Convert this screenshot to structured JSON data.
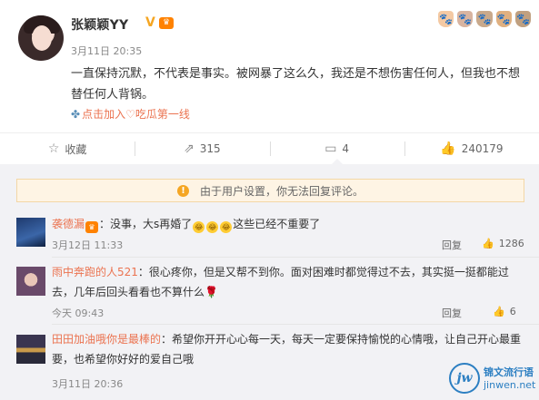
{
  "post": {
    "username": "张颖颖YY",
    "verified_mark": "V",
    "level_badge": "♛",
    "time": "3月11日 20:35",
    "content": "一直保持沉默，不代表是事实。被网暴了这么久，我还是不想伤害任何人，但我也不想替任何人背锅。",
    "topic_icon": "✤",
    "topic": "点击加入♡吃瓜第一线",
    "deco_cats": [
      "🐾",
      "🐾",
      "🐾",
      "🐾",
      "🐾"
    ]
  },
  "actions": {
    "favorite_icon": "star-icon",
    "favorite_glyph": "☆",
    "favorite_label": "收藏",
    "repost_icon": "share-icon",
    "repost_glyph": "⇗",
    "repost_count": "315",
    "comment_icon": "comment-icon",
    "comment_glyph": "▭",
    "comment_count": "4",
    "like_icon": "thumb-up-icon",
    "like_glyph": "👍",
    "like_count": "240179"
  },
  "notice": {
    "icon": "!",
    "text": "由于用户设置，你无法回复评论。"
  },
  "comments": [
    {
      "name": "袭德漏",
      "text_before": "：没事，大s再婚了",
      "emojis": [
        "😂",
        "😂",
        "😂"
      ],
      "text_after": "这些已经不重要了",
      "time": "3月12日 11:33",
      "reply": "回复",
      "likes": "1286"
    },
    {
      "name": "雨中奔跑的人521",
      "text": "：很心疼你，但是又帮不到你。面对困难时都觉得过不去，其实挺一挺都能过去，几年后回头看看也不算什么",
      "rose": "🌹",
      "time": "今天 09:43",
      "reply": "回复",
      "likes": "6"
    },
    {
      "name": "田田加油哦你是最棒的",
      "text": "：希望你开开心心每一天，每天一定要保持愉悦的心情哦，让自己开心最重要，也希望你好好的爱自己哦",
      "time": "3月11日 20:36"
    }
  ],
  "watermark": {
    "logo": "jw",
    "line1": "锦文流行语",
    "line2": "jinwen.net"
  },
  "colors": {
    "accent": "#eb7350",
    "link": "#eb7350",
    "notice_bg": "#fef4e4",
    "watermark": "#2c7fc2"
  }
}
